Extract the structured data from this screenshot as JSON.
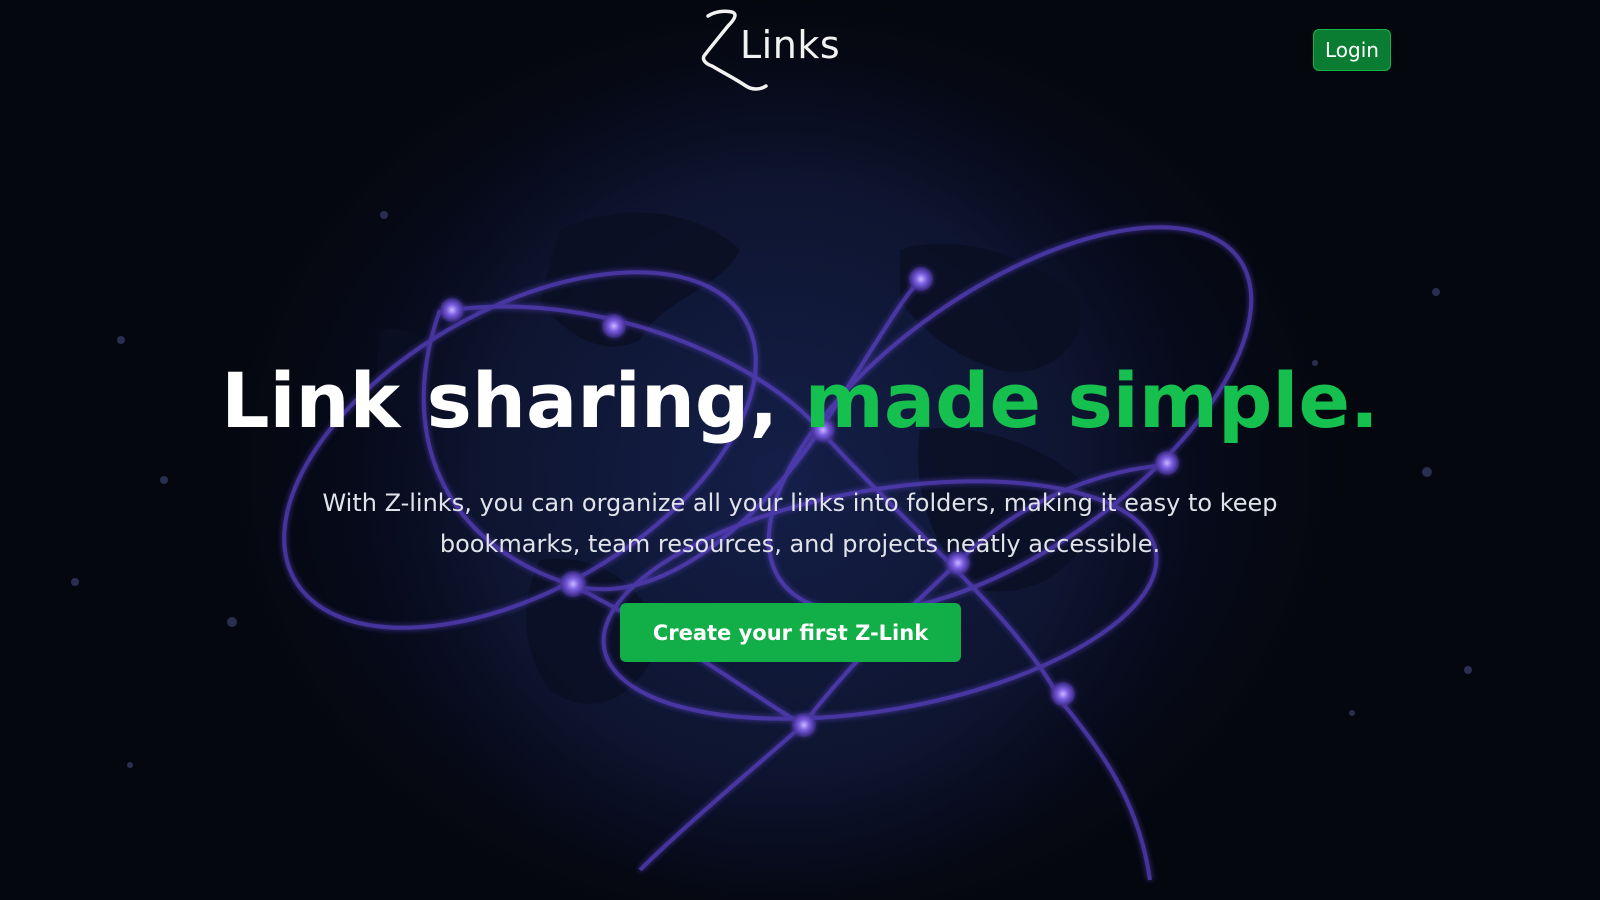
{
  "header": {
    "logo_text": "Links",
    "login_label": "Login"
  },
  "hero": {
    "headline_main": "Link sharing, ",
    "headline_accent": "made simple.",
    "subtext": "With Z-links, you can organize all your links into folders, making it easy to keep bookmarks, team resources, and projects neatly accessible.",
    "cta_label": "Create your first Z-Link"
  },
  "colors": {
    "background": "#060814",
    "accent_green": "#16c04f",
    "button_green": "#12ae47",
    "orbit_purple": "#6a4fd0"
  }
}
